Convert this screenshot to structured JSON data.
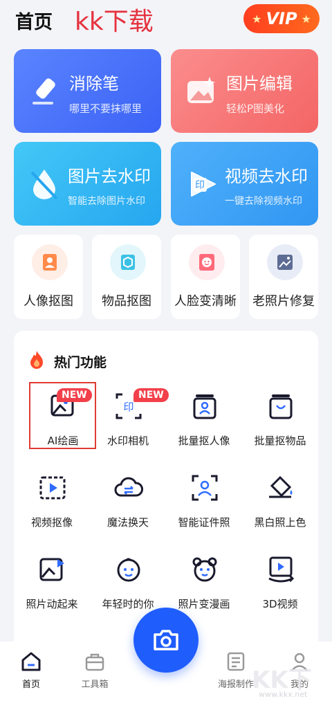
{
  "header": {
    "title": "首页",
    "watermark": "kk下载",
    "vip_label": "VIP"
  },
  "big_cards": [
    {
      "title": "消除笔",
      "subtitle": "哪里不要抹哪里"
    },
    {
      "title": "图片编辑",
      "subtitle": "轻松P图美化"
    },
    {
      "title": "图片去水印",
      "subtitle": "智能去除图片水印"
    },
    {
      "title": "视频去水印",
      "subtitle": "一键去除视频水印"
    }
  ],
  "small_cards": [
    {
      "label": "人像抠图"
    },
    {
      "label": "物品抠图"
    },
    {
      "label": "人脸变清晰"
    },
    {
      "label": "老照片修复"
    }
  ],
  "hot": {
    "title": "热门功能",
    "new_badge": "NEW",
    "features": [
      {
        "label": "AI绘画"
      },
      {
        "label": "水印相机"
      },
      {
        "label": "批量抠人像"
      },
      {
        "label": "批量抠物品"
      },
      {
        "label": "视频抠像"
      },
      {
        "label": "魔法换天"
      },
      {
        "label": "智能证件照"
      },
      {
        "label": "黑白照上色"
      },
      {
        "label": "照片动起来"
      },
      {
        "label": "年轻时的你"
      },
      {
        "label": "照片变漫画"
      },
      {
        "label": "3D视频"
      }
    ]
  },
  "nav": {
    "items": [
      {
        "label": "首页"
      },
      {
        "label": "工具箱"
      },
      {
        "label": "海报制作"
      },
      {
        "label": "我的"
      }
    ]
  },
  "watermark_bottom": {
    "text": "KK下载",
    "url": "www.kkx.net"
  },
  "colors": {
    "primary": "#1f5dfc",
    "badge": "#f2404b",
    "vip": "#ff5a1e"
  }
}
